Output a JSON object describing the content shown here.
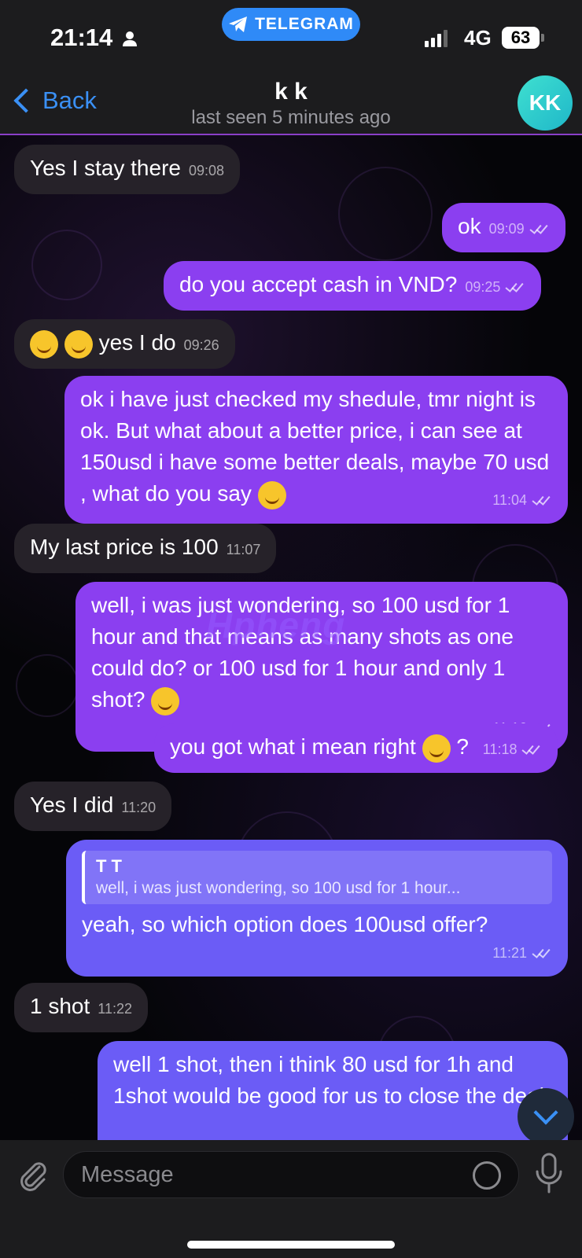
{
  "status_bar": {
    "time": "21:14",
    "app_pill": "TELEGRAM",
    "network": "4G",
    "battery": "63"
  },
  "header": {
    "back_label": "Back",
    "contact_name": "k k",
    "last_seen": "last seen 5 minutes ago",
    "avatar_initials": "KK"
  },
  "messages": [
    {
      "dir": "in",
      "text": "Yes I stay there",
      "time": "09:08"
    },
    {
      "dir": "out",
      "text": "ok",
      "time": "09:09"
    },
    {
      "dir": "out",
      "text": "do you accept cash in VND?",
      "time": "09:25"
    },
    {
      "dir": "in",
      "text": "yes I do",
      "time": "09:26"
    },
    {
      "dir": "out",
      "text": "ok i have just checked my shedule, tmr night is ok. But what about a better price, i can see at 150usd i have some better deals, maybe 70 usd , what do you say",
      "time": "11:04"
    },
    {
      "dir": "in",
      "text": "My last price is 100",
      "time": "11:07"
    },
    {
      "dir": "out",
      "text": "well, i was just wondering, so 100 usd for 1 hour and that means as many shots as one could do? or 100 usd for 1 hour and only 1 shot?",
      "time": "11:16"
    },
    {
      "dir": "out",
      "text": "you got what i mean right",
      "suffix": "?",
      "time": "11:18"
    },
    {
      "dir": "in",
      "text": "Yes I did",
      "time": "11:20"
    },
    {
      "dir": "out",
      "reply_name": "T T",
      "reply_text": "well, i was just wondering, so 100 usd for 1 hour...",
      "text": "yeah, so which option does 100usd offer?",
      "time": "11:21"
    },
    {
      "dir": "in",
      "text": "1 shot",
      "time": "11:22"
    },
    {
      "dir": "out",
      "text": "well 1 shot, then i think 80 usd for 1h and 1shot would be good for us to close the deal"
    }
  ],
  "watermark": "Hpheng",
  "input": {
    "placeholder": "Message"
  },
  "icons": [
    "person-icon",
    "telegram-icon",
    "signal-icon",
    "battery-icon",
    "back-chevron-icon",
    "paperclip-icon",
    "sticker-icon",
    "microphone-icon",
    "scroll-down-icon"
  ]
}
